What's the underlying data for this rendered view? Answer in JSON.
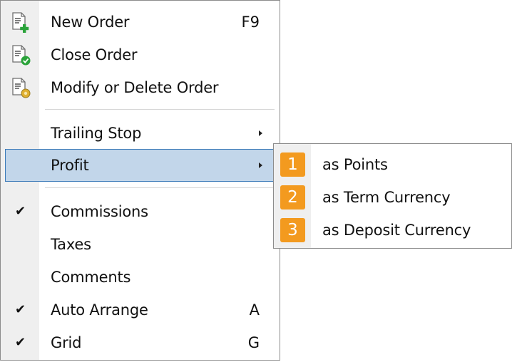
{
  "menu": {
    "items": [
      {
        "label": "New Order",
        "shortcut": "F9",
        "icon": "new-order-icon"
      },
      {
        "label": "Close Order",
        "icon": "close-order-icon"
      },
      {
        "label": "Modify or Delete Order",
        "icon": "modify-order-icon"
      },
      {
        "label": "Trailing Stop",
        "has_submenu": true
      },
      {
        "label": "Profit",
        "has_submenu": true,
        "highlighted": true
      },
      {
        "label": "Commissions",
        "checked": true
      },
      {
        "label": "Taxes"
      },
      {
        "label": "Comments"
      },
      {
        "label": "Auto Arrange",
        "shortcut": "A",
        "checked": true
      },
      {
        "label": "Grid",
        "shortcut": "G",
        "checked": true
      }
    ],
    "check_glyph": "✔"
  },
  "submenu": {
    "items": [
      {
        "badge": "1",
        "label": "as Points"
      },
      {
        "badge": "2",
        "label": "as Term Currency"
      },
      {
        "badge": "3",
        "label": "as Deposit Currency"
      }
    ],
    "badge_color": "#f39a1f"
  },
  "colors": {
    "highlight_bg": "#c2d6ea",
    "highlight_border": "#3a79b8",
    "gutter": "#efefef"
  }
}
